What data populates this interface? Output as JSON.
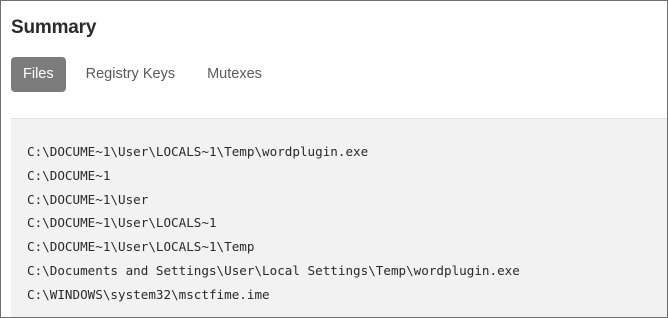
{
  "summary": {
    "title": "Summary"
  },
  "tabs": [
    {
      "label": "Files",
      "active": true
    },
    {
      "label": "Registry Keys",
      "active": false
    },
    {
      "label": "Mutexes",
      "active": false
    }
  ],
  "files": [
    "C:\\DOCUME~1\\User\\LOCALS~1\\Temp\\wordplugin.exe",
    "C:\\DOCUME~1",
    "C:\\DOCUME~1\\User",
    "C:\\DOCUME~1\\User\\LOCALS~1",
    "C:\\DOCUME~1\\User\\LOCALS~1\\Temp",
    "C:\\Documents and Settings\\User\\Local Settings\\Temp\\wordplugin.exe",
    "C:\\WINDOWS\\system32\\msctfime.ime"
  ],
  "colors": {
    "active_tab_bg": "#7c7c7c",
    "panel_bg": "#f2f2f2"
  }
}
